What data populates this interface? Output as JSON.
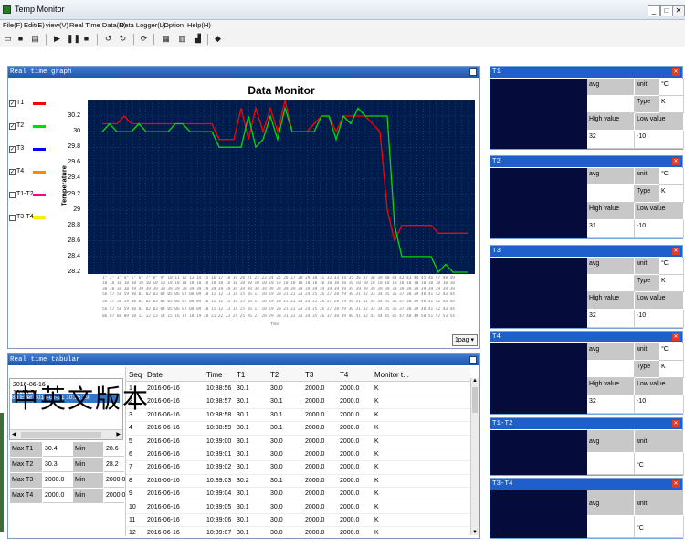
{
  "window": {
    "title": "Temp Monitor",
    "min": "_",
    "max": "□",
    "close": "✕"
  },
  "menu": [
    "File(F)",
    "Edit(E)",
    "view(V)",
    "Real Time Data(R)",
    "Data Logger(L)",
    "Option",
    "Help(H)"
  ],
  "toolbar_icons": [
    "open-icon",
    "save-icon",
    "print-icon",
    "play-icon",
    "pause-icon",
    "stop-icon",
    "undo-icon",
    "redo-icon",
    "refresh-icon",
    "table-icon",
    "grid-icon",
    "chart-icon",
    "diamond-icon"
  ],
  "graph": {
    "panel_title": "Real time graph",
    "series_toggles": [
      {
        "label": "T1",
        "checked": true,
        "color": "#ff0000"
      },
      {
        "label": "T2",
        "checked": true,
        "color": "#00dd00"
      },
      {
        "label": "T3",
        "checked": true,
        "color": "#0000ff"
      },
      {
        "label": "T4",
        "checked": true,
        "color": "#ff8800"
      },
      {
        "label": "T1-T2",
        "checked": false,
        "color": "#ff0088"
      },
      {
        "label": "T3-T4",
        "checked": false,
        "color": "#ffee00"
      }
    ],
    "page_select": "1pag"
  },
  "chart_data": {
    "type": "line",
    "title": "Data Monitor",
    "ylabel": "Temperature",
    "xlabel": "Time",
    "ylim": [
      28.2,
      30.2
    ],
    "yticks": [
      30.2,
      30.0,
      29.8,
      29.6,
      29.4,
      29.2,
      29.0,
      28.8,
      28.6,
      28.4,
      28.2
    ],
    "grid": true,
    "series": [
      {
        "name": "T1",
        "color": "#ff0000",
        "values": [
          30.1,
          30.1,
          30.1,
          30.2,
          30.1,
          30.1,
          30.1,
          30.1,
          30.1,
          30.1,
          30.1,
          30.1,
          30.1,
          30.1,
          30.1,
          30.1,
          29.9,
          29.9,
          29.9,
          30.3,
          29.9,
          30.3,
          30.0,
          30.3,
          30.0,
          30.4,
          30.0,
          30.0,
          30.0,
          30.1,
          30.2,
          30.2,
          30.0,
          30.2,
          30.2,
          30.2,
          30.2,
          30.1,
          30.0,
          29.0,
          28.6,
          28.8,
          28.8,
          28.8,
          28.8,
          28.8,
          28.7,
          28.7,
          28.7,
          28.7,
          28.7
        ]
      },
      {
        "name": "T2",
        "color": "#00dd00",
        "values": [
          30.0,
          30.1,
          30.0,
          30.0,
          30.0,
          30.1,
          30.0,
          30.0,
          30.0,
          30.0,
          30.1,
          30.1,
          30.0,
          30.0,
          30.0,
          30.0,
          29.8,
          29.8,
          29.8,
          29.8,
          30.2,
          29.8,
          29.9,
          30.2,
          29.9,
          30.3,
          30.0,
          30.0,
          30.0,
          30.0,
          30.2,
          30.2,
          29.9,
          30.2,
          30.1,
          30.3,
          30.2,
          30.2,
          30.2,
          30.2,
          28.8,
          28.4,
          28.4,
          28.4,
          28.4,
          28.4,
          28.2,
          28.3,
          28.2,
          28.2,
          28.2
        ]
      }
    ]
  },
  "tabular": {
    "panel_title": "Real time tabular",
    "left_list": [
      {
        "date": "2016-06-16",
        "time": "10:38:56"
      }
    ],
    "selected_item": "80 Ever    2016-07-01 10:35:19",
    "stats": [
      {
        "label": "Max T1",
        "value": "30.4",
        "mlabel": "Min",
        "mvalue": "28.6"
      },
      {
        "label": "Max T2",
        "value": "30.3",
        "mlabel": "Min",
        "mvalue": "28.2"
      },
      {
        "label": "Max T3",
        "value": "2000.0",
        "mlabel": "Min",
        "mvalue": "2000.0"
      },
      {
        "label": "Max T4",
        "value": "2000.0",
        "mlabel": "Min",
        "mvalue": "2000.0"
      }
    ],
    "columns": [
      "Seq",
      "Date",
      "Time",
      "T1",
      "T2",
      "T3",
      "T4",
      "Monitor t..."
    ],
    "rows": [
      [
        "1",
        "2016-06-16",
        "10:38:56",
        "30.1",
        "30.0",
        "2000.0",
        "2000.0",
        "K"
      ],
      [
        "2",
        "2016-06-16",
        "10:38:57",
        "30.1",
        "30.1",
        "2000.0",
        "2000.0",
        "K"
      ],
      [
        "3",
        "2016-06-16",
        "10:38:58",
        "30.1",
        "30.1",
        "2000.0",
        "2000.0",
        "K"
      ],
      [
        "4",
        "2016-06-16",
        "10:38:59",
        "30.1",
        "30.1",
        "2000.0",
        "2000.0",
        "K"
      ],
      [
        "5",
        "2016-06-16",
        "10:39:00",
        "30.1",
        "30.0",
        "2000.0",
        "2000.0",
        "K"
      ],
      [
        "6",
        "2016-06-16",
        "10:39:01",
        "30.1",
        "30.0",
        "2000.0",
        "2000.0",
        "K"
      ],
      [
        "7",
        "2016-06-16",
        "10:39:02",
        "30.1",
        "30.0",
        "2000.0",
        "2000.0",
        "K"
      ],
      [
        "8",
        "2016-06-16",
        "10:39:03",
        "30.2",
        "30.1",
        "2000.0",
        "2000.0",
        "K"
      ],
      [
        "9",
        "2016-06-16",
        "10:39:04",
        "30.1",
        "30.0",
        "2000.0",
        "2000.0",
        "K"
      ],
      [
        "10",
        "2016-06-16",
        "10:39:05",
        "30.1",
        "30.0",
        "2000.0",
        "2000.0",
        "K"
      ],
      [
        "11",
        "2016-06-16",
        "10:39:06",
        "30.1",
        "30.0",
        "2000.0",
        "2000.0",
        "K"
      ],
      [
        "12",
        "2016-06-16",
        "10:39:07",
        "30.1",
        "30.0",
        "2000.0",
        "2000.0",
        "K"
      ]
    ]
  },
  "watermark": "中英文版本",
  "right_panels": [
    {
      "id": "t1",
      "title": "T1",
      "avg": "avg",
      "unit_label": "unit",
      "unit": "°C",
      "type_label": "Type",
      "type": "K",
      "high_label": "High value",
      "low_label": "Low value",
      "high": "32",
      "low": "-10"
    },
    {
      "id": "t2",
      "title": "T2",
      "avg": "avg",
      "unit_label": "unit",
      "unit": "°C",
      "type_label": "Type",
      "type": "K",
      "high_label": "High value",
      "low_label": "Low value",
      "high": "31",
      "low": "-10"
    },
    {
      "id": "t3",
      "title": "T3",
      "avg": "avg",
      "unit_label": "unit",
      "unit": "°C",
      "type_label": "Type",
      "type": "K",
      "high_label": "High value",
      "low_label": "Low value",
      "high": "32",
      "low": "-10"
    },
    {
      "id": "t4",
      "title": "T4",
      "avg": "avg",
      "unit_label": "unit",
      "unit": "°C",
      "type_label": "Type",
      "type": "K",
      "high_label": "High value",
      "low_label": "Low value",
      "high": "32",
      "low": "-10"
    }
  ],
  "diff_panels": [
    {
      "id": "t1t2",
      "title": "T1-T2",
      "avg": "avg",
      "unit_label": "unit",
      "unit": "°C"
    },
    {
      "id": "t3t4",
      "title": "T3-T4",
      "avg": "avg",
      "unit_label": "unit",
      "unit": "°C"
    }
  ]
}
